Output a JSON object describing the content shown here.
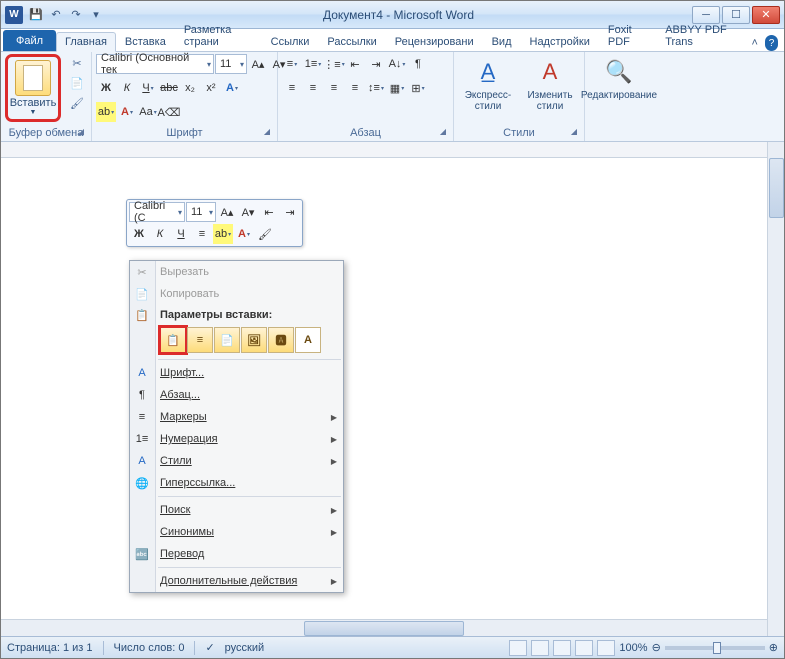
{
  "titlebar": {
    "title": "Документ4 - Microsoft Word"
  },
  "tabs": {
    "file": "Файл",
    "items": [
      "Главная",
      "Вставка",
      "Разметка страни",
      "Ссылки",
      "Рассылки",
      "Рецензировани",
      "Вид",
      "Надстройки",
      "Foxit PDF",
      "ABBYY PDF Trans"
    ]
  },
  "ribbon": {
    "clipboard": {
      "paste": "Вставить",
      "label": "Буфер обмена"
    },
    "font": {
      "name": "Calibri (Основной тек",
      "size": "11",
      "label": "Шрифт"
    },
    "para": {
      "label": "Абзац"
    },
    "styles": {
      "quick": "Экспресс-стили",
      "change": "Изменить стили",
      "label": "Стили"
    },
    "edit": {
      "label": "Редактирование"
    }
  },
  "minitb": {
    "font": "Calibri (С",
    "size": "11"
  },
  "ctx": {
    "cut": "Вырезать",
    "copy": "Копировать",
    "paste_opts": "Параметры вставки:",
    "font": "Шрифт...",
    "para": "Абзац...",
    "bullets": "Маркеры",
    "numbering": "Нумерация",
    "styles": "Стили",
    "hyperlink": "Гиперссылка...",
    "search": "Поиск",
    "synonyms": "Синонимы",
    "translate": "Перевод",
    "more": "Дополнительные действия"
  },
  "status": {
    "page": "Страница: 1 из 1",
    "words": "Число слов: 0",
    "lang": "русский",
    "zoom": "100%"
  }
}
